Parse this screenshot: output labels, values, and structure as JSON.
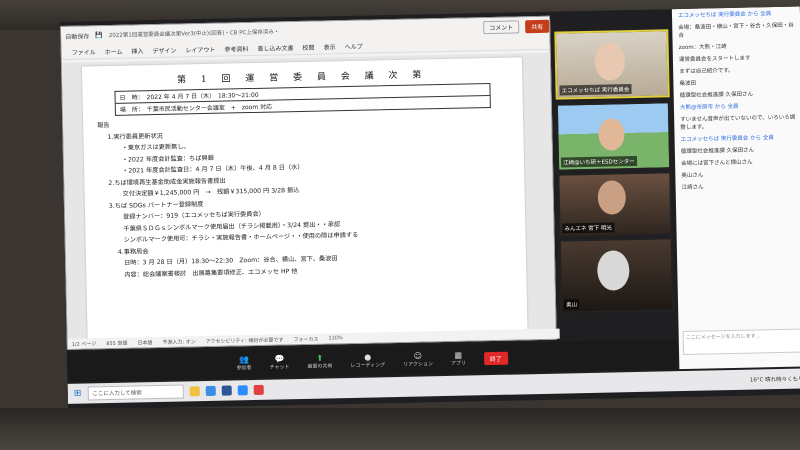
{
  "word": {
    "title_text": "2022第1回運営委員会議次第Ver3(中止)(回答)・CB PC上保存済み・",
    "autosave_label": "自動保存",
    "comment_label": "コメント",
    "share_label": "共有",
    "ribbon_tabs": [
      "ファイル",
      "ホーム",
      "挿入",
      "デザイン",
      "レイアウト",
      "参考資料",
      "差し込み文書",
      "校閲",
      "表示",
      "ヘルプ"
    ],
    "meeting_title": "第 1 回 運 営 委 員 会 議 次 第",
    "info_rows": [
      "日　時：　2022 年 4 月 7 日（木）　18:30～21:00",
      "場　所：　千葉市民活動センター会議室　+　zoom 対応"
    ],
    "body_lines": [
      {
        "text": "報告",
        "cls": ""
      },
      {
        "text": "1.実行委員更新状況",
        "cls": "ind1"
      },
      {
        "text": "・東京ガスは更新無し。",
        "cls": "ind3"
      },
      {
        "text": "・2022 年度会計監査：ちば興銀",
        "cls": "ind3"
      },
      {
        "text": "・2021 年度会計監査日：4 月 7 日（木）午後、4 月 8 日（水）",
        "cls": "ind3"
      },
      {
        "text": "2.ちば環境再生基金助成金実施報告書提出",
        "cls": "ind1"
      },
      {
        "text": "交付決定額￥1,245,000 円　→　残額￥315,000 円 3/28 振込",
        "cls": "ind3"
      },
      {
        "text": "3.ちば SDGs パートナー登録制度",
        "cls": "ind1"
      },
      {
        "text": "登録ナンバー：919（エコメッセちば実行委員会）",
        "cls": "ind3"
      },
      {
        "text": "千葉県ＳＤＧｓシンボルマーク使用届出（チラシ掲載用）・3/24 提出・・承認",
        "cls": "ind3"
      },
      {
        "text": "シンボルマーク使用可：チラシ・実施報告書・ホームページ・・使用の際は申請する",
        "cls": "ind3"
      },
      {
        "text": "4.事務局会",
        "cls": "ind2"
      },
      {
        "text": "日時：3 月 28 日（月）18:30～22:30　Zoom：谷合、横山、宮下、桑波田",
        "cls": "ind3"
      },
      {
        "text": "内容：総会議案書検討　出展募集要項修正、エコメッセ HP 他",
        "cls": "ind3"
      }
    ],
    "status_items": [
      "1/2 ページ",
      "855 単語",
      "日本語",
      "予測入力: オン",
      "アクセシビリティ: 検討が必要です",
      "フォーカス",
      "110%"
    ]
  },
  "tiles": [
    {
      "name": "エコメッセちば 実行委員会"
    },
    {
      "name": "江崎@いち研＋ESDセンター"
    },
    {
      "name": "みんエネ 宮下 明光"
    },
    {
      "name": "奥山"
    }
  ],
  "chat": {
    "messages": [
      {
        "sender": "エコメッセちば 実行委員会 から 全員",
        "text": ""
      },
      {
        "text": "会場：桑波田・横山・宮下・谷合・久保田・谷合"
      },
      {
        "text": "zoom：大熊・江崎"
      },
      {
        "text": "運営委員会をスタートします"
      },
      {
        "text": "まずは自己紹介です。"
      },
      {
        "text": "桑波田"
      },
      {
        "text": "循環型社会推進課 久保田さん"
      },
      {
        "sender": "大熊@市原市 から 全員",
        "text": ""
      },
      {
        "text": "すいません音声が出ていないので、いろいろ調整します。"
      },
      {
        "sender": "エコメッセちば 実行委員会 から 全員",
        "text": ""
      },
      {
        "text": "循環型社会推進課 久保田さん"
      },
      {
        "text": "会場には宮下さんと横山さん"
      },
      {
        "text": "奥山さん"
      },
      {
        "text": "江崎さん"
      }
    ],
    "input_placeholder": "ここにメッセージを入力します..."
  },
  "zoom_controls": [
    "参加者",
    "チャット",
    "画面の共有",
    "レコーディング",
    "リアクション",
    "アプリ"
  ],
  "end_label": "終了",
  "taskbar": {
    "search_placeholder": "ここに入力して検索",
    "tray_text": "16°C 晴れ時々くもり"
  }
}
